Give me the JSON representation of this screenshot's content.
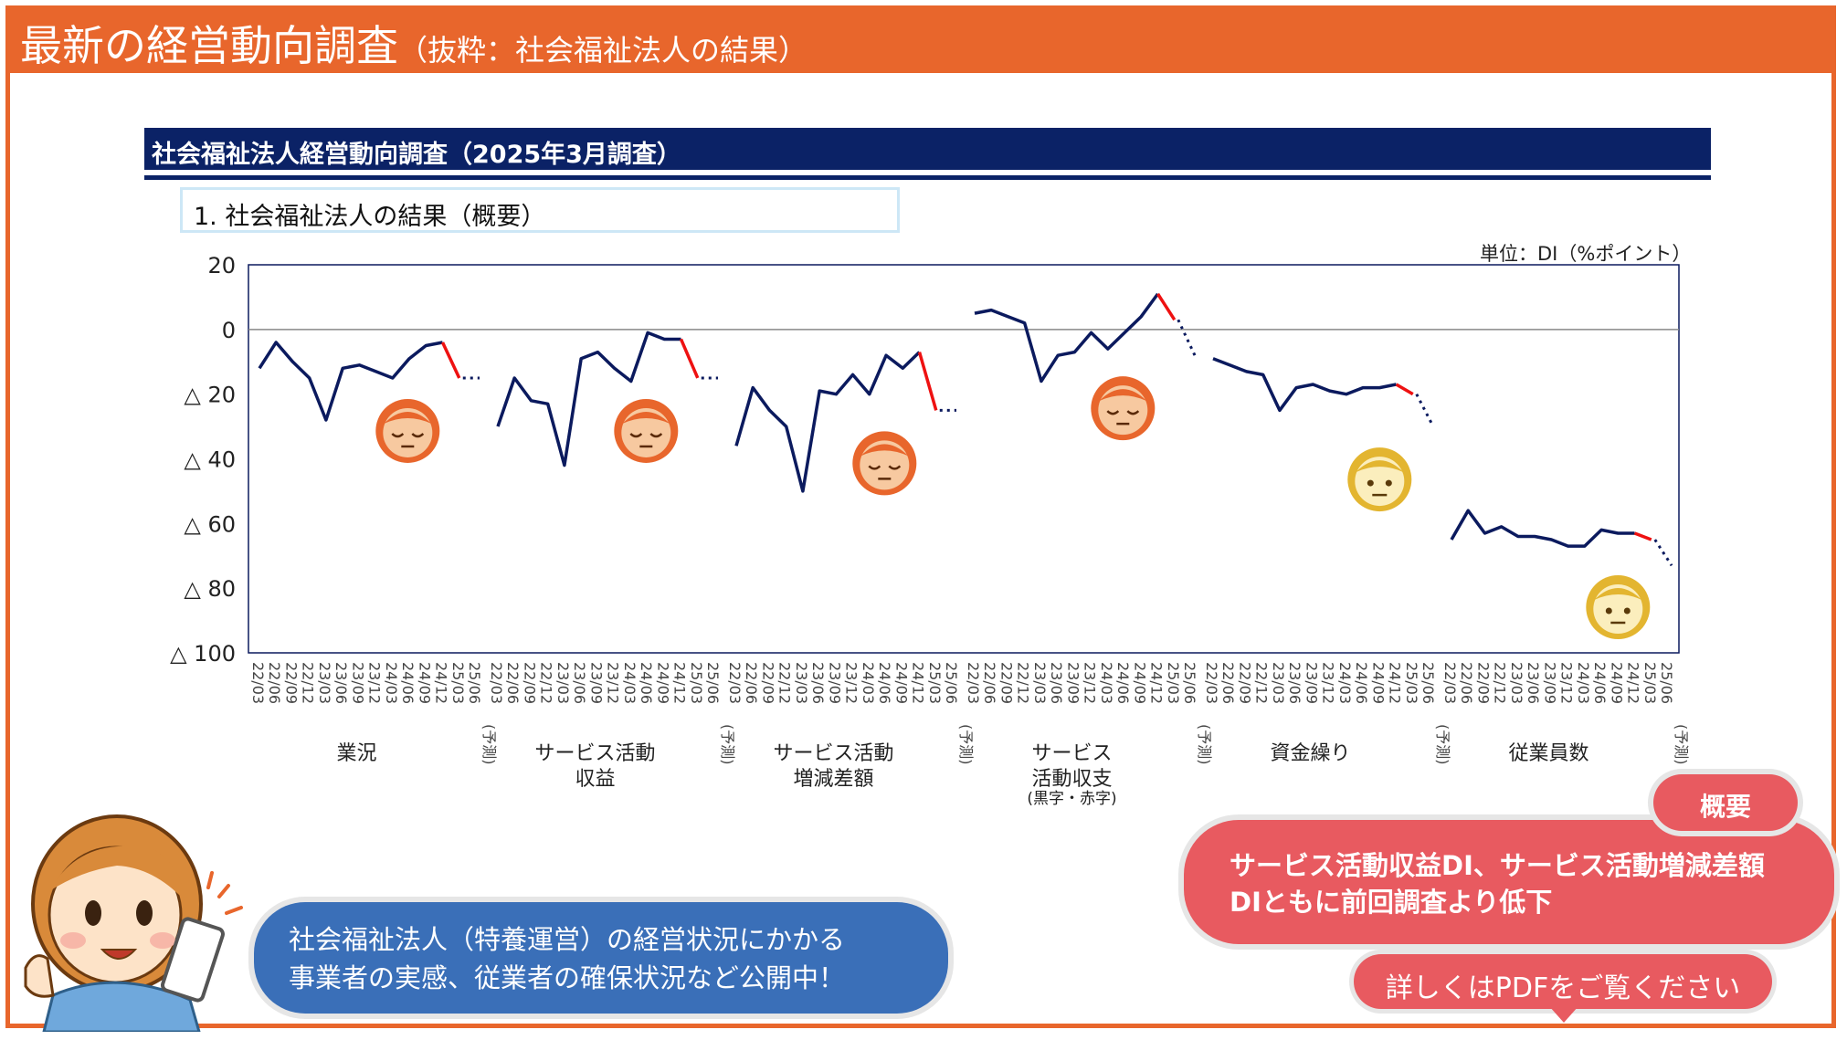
{
  "header": {
    "title": "最新の経営動向調査",
    "subtitle": "（抜粋：社会福祉法人の結果）"
  },
  "report": {
    "title": "社会福祉法人経営動向調査（2025年3月調査）",
    "section": "1. 社会福祉法人の結果（概要）",
    "unit": "単位：DI（%ポイント）"
  },
  "chart_data": {
    "type": "line",
    "ylim": [
      -100,
      20
    ],
    "yticks": [
      20,
      0,
      -20,
      -40,
      -60,
      -80,
      -100
    ],
    "ytick_labels": [
      "20",
      "0",
      "△ 20",
      "△ 40",
      "△ 60",
      "△ 80",
      "△ 100"
    ],
    "grid": false,
    "baseline": 0,
    "x": [
      "22/03",
      "22/06",
      "22/09",
      "22/12",
      "23/03",
      "23/06",
      "23/09",
      "23/12",
      "24/03",
      "24/06",
      "24/09",
      "24/12",
      "25/03",
      "25/06"
    ],
    "forecast_label": "(予測)",
    "series_colors": {
      "actual": "#0b1a5e",
      "latest_change": "#ee1111",
      "forecast": "#0b1a5e"
    },
    "panels": [
      {
        "name": "業況",
        "values": [
          -12,
          -4,
          -10,
          -15,
          -28,
          -12,
          -11,
          -13,
          -15,
          -9,
          -5,
          -4,
          -15,
          -15
        ]
      },
      {
        "name": "サービス活動 収益",
        "values": [
          -30,
          -15,
          -22,
          -23,
          -42,
          -9,
          -7,
          -12,
          -16,
          -1,
          -3,
          -3,
          -15,
          -15
        ]
      },
      {
        "name": "サービス活動 増減差額",
        "values": [
          -36,
          -18,
          -25,
          -30,
          -50,
          -19,
          -20,
          -14,
          -20,
          -8,
          -12,
          -7,
          -25,
          -25
        ]
      },
      {
        "name": "サービス 活動収支",
        "note": "(黒字・赤字)",
        "values": [
          5,
          6,
          4,
          2,
          -16,
          -8,
          -7,
          -1,
          -6,
          -1,
          4,
          11,
          3,
          -8
        ]
      },
      {
        "name": "資金繰り",
        "values": [
          -9,
          -11,
          -13,
          -14,
          -25,
          -18,
          -17,
          -19,
          -20,
          -18,
          -18,
          -17,
          -20,
          -30
        ]
      },
      {
        "name": "従業員数",
        "values": [
          -65,
          -56,
          -63,
          -61,
          -64,
          -64,
          -65,
          -67,
          -67,
          -62,
          -63,
          -63,
          -65,
          -73
        ]
      }
    ],
    "faces": [
      "sleepy-orange",
      "sleepy-orange",
      "sleepy-orange",
      "sleepy-orange",
      "neutral-yellow",
      "neutral-yellow"
    ]
  },
  "face_colors": {
    "orange": "#e8662c",
    "yellow": "#e3b530"
  },
  "callouts": {
    "left_line1": "社会福祉法人（特養運営）の経営状況にかかる",
    "left_line2": "事業者の実感、従業者の確保状況など公開中！",
    "summary_tag": "概要",
    "right_line1": "サービス活動収益DI、サービス活動増減差額",
    "right_line2": "DIともに前回調査より低下",
    "pdf_button": "詳しくはPDFをご覧ください"
  }
}
